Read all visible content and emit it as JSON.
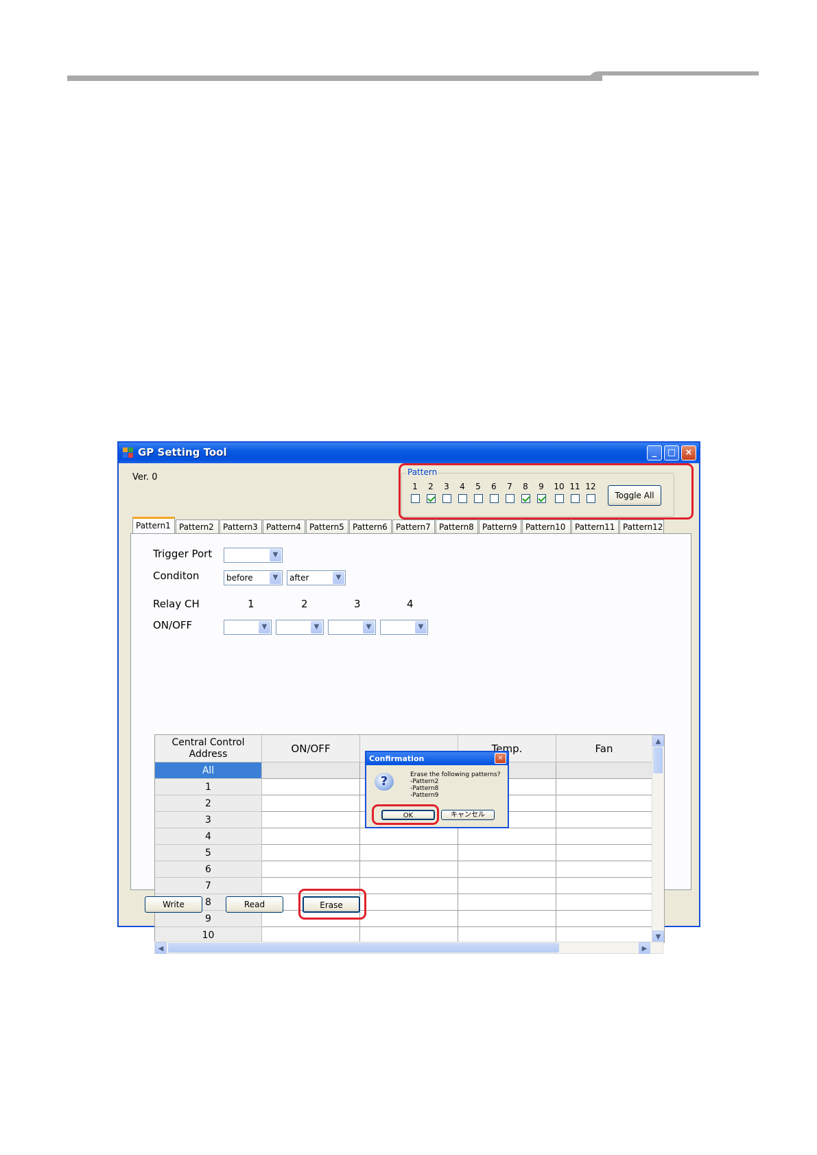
{
  "window": {
    "title": "GP Setting Tool",
    "version": "Ver. 0",
    "minimize_glyph": "_",
    "maximize_glyph": "□",
    "close_glyph": "×"
  },
  "pattern_group": {
    "legend": "Pattern",
    "items": [
      {
        "num": "1",
        "checked": false
      },
      {
        "num": "2",
        "checked": true
      },
      {
        "num": "3",
        "checked": false
      },
      {
        "num": "4",
        "checked": false
      },
      {
        "num": "5",
        "checked": false
      },
      {
        "num": "6",
        "checked": false
      },
      {
        "num": "7",
        "checked": false
      },
      {
        "num": "8",
        "checked": true
      },
      {
        "num": "9",
        "checked": true
      },
      {
        "num": "10",
        "checked": false
      },
      {
        "num": "11",
        "checked": false
      },
      {
        "num": "12",
        "checked": false
      }
    ],
    "toggle_all": "Toggle All"
  },
  "tabs": [
    "Pattern1",
    "Pattern2",
    "Pattern3",
    "Pattern4",
    "Pattern5",
    "Pattern6",
    "Pattern7",
    "Pattern8",
    "Pattern9",
    "Pattern10",
    "Pattern11",
    "Pattern12"
  ],
  "form": {
    "trigger_port_label": "Trigger Port",
    "trigger_port_value": "",
    "condition_label": "Conditon",
    "condition_before": "before",
    "condition_after": "after",
    "relay_label": "Relay CH",
    "relay_channels": [
      "1",
      "2",
      "3",
      "4"
    ],
    "onoff_label": "ON/OFF"
  },
  "grid": {
    "header_address_line1": "Central Control",
    "header_address_line2": "Address",
    "header_onoff": "ON/OFF",
    "header_temp": "Temp.",
    "header_fan": "Fan",
    "rows": [
      "All",
      "1",
      "2",
      "3",
      "4",
      "5",
      "6",
      "7",
      "8",
      "9",
      "10"
    ]
  },
  "dialog": {
    "title": "Confirmation",
    "message": "Erase the following patterns?\n-Pattern2\n-Pattern8\n-Pattern9",
    "ok": "OK",
    "cancel": "キャンセル"
  },
  "buttons": {
    "write": "Write",
    "read": "Read",
    "erase": "Erase"
  },
  "colors": {
    "highlight": "#e0202a",
    "titlebar": "#0050de",
    "selected_row": "#3b80d6"
  }
}
